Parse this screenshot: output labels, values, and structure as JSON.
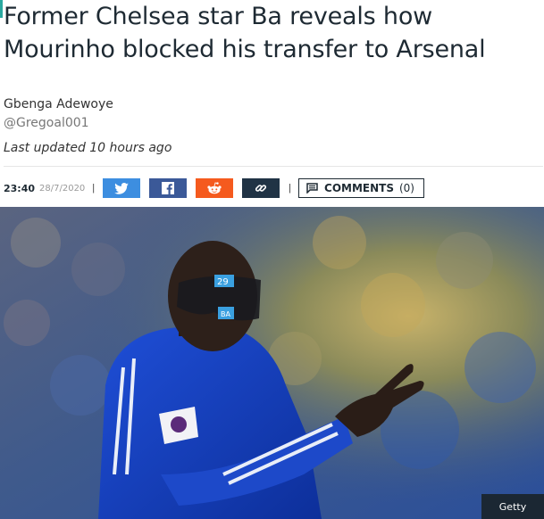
{
  "article": {
    "headline": "Former Chelsea star Ba reveals how Mourinho blocked his transfer to Arsenal",
    "author_name": "Gbenga Adewoye",
    "author_handle": "@Gregoal001",
    "last_updated": "Last updated 10 hours ago",
    "time": "23:40",
    "date": "28/7/2020"
  },
  "share": {
    "icons": [
      "twitter-icon",
      "facebook-icon",
      "reddit-icon",
      "link-icon"
    ],
    "colors": {
      "twitter": "#3d8ee0",
      "facebook": "#3b5998",
      "reddit": "#f55a1e",
      "link": "#203345"
    }
  },
  "comments": {
    "label": "COMMENTS",
    "count": "(0)"
  },
  "image": {
    "credit": "Getty",
    "badge_number": "29",
    "badge_letters": "BA"
  },
  "colors": {
    "accent": "#2aa8a0",
    "headline": "#1e2a33"
  }
}
